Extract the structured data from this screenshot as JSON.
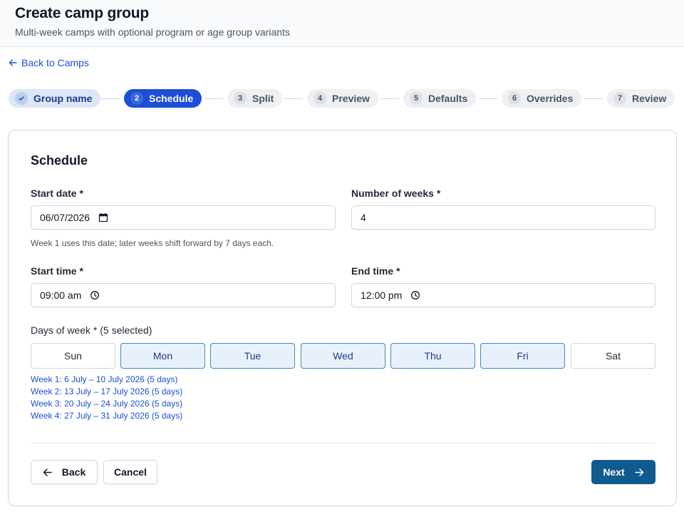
{
  "header": {
    "title": "Create camp group",
    "subtitle": "Multi-week camps with optional program or age group variants"
  },
  "back_link": "Back to Camps",
  "steps": [
    {
      "num": "",
      "label": "Group name",
      "state": "done"
    },
    {
      "num": "2",
      "label": "Schedule",
      "state": "active"
    },
    {
      "num": "3",
      "label": "Split",
      "state": "pending"
    },
    {
      "num": "4",
      "label": "Preview",
      "state": "pending"
    },
    {
      "num": "5",
      "label": "Defaults",
      "state": "pending"
    },
    {
      "num": "6",
      "label": "Overrides",
      "state": "pending"
    },
    {
      "num": "7",
      "label": "Review",
      "state": "pending"
    }
  ],
  "schedule": {
    "heading": "Schedule",
    "start_date_label": "Start date *",
    "start_date_value": "06/07/2026",
    "start_date_hint": "Week 1 uses this date; later weeks shift forward by 7 days each.",
    "weeks_label": "Number of weeks *",
    "weeks_value": "4",
    "start_time_label": "Start time *",
    "start_time_value": "09:00 am",
    "end_time_label": "End time *",
    "end_time_value": "12:00 pm",
    "days_label": "Days of week * (5 selected)",
    "days": [
      {
        "label": "Sun",
        "selected": false
      },
      {
        "label": "Mon",
        "selected": true
      },
      {
        "label": "Tue",
        "selected": true
      },
      {
        "label": "Wed",
        "selected": true
      },
      {
        "label": "Thu",
        "selected": true
      },
      {
        "label": "Fri",
        "selected": true
      },
      {
        "label": "Sat",
        "selected": false
      }
    ],
    "week_summaries": [
      "Week 1: 6 July – 10 July 2026 (5 days)",
      "Week 2: 13 July – 17 July 2026 (5 days)",
      "Week 3: 20 July – 24 July 2026 (5 days)",
      "Week 4: 27 July – 31 July 2026 (5 days)"
    ]
  },
  "footer": {
    "back_label": "Back",
    "cancel_label": "Cancel",
    "next_label": "Next"
  },
  "colors": {
    "accent": "#1d4ed8",
    "primary_button": "#0f5b8e",
    "selected_day_bg": "#e8f1fb"
  },
  "icons": {
    "back_link": "arrow-left-icon",
    "done_step": "check-icon",
    "date_field": "calendar-icon",
    "time_field": "clock-icon",
    "back_button": "arrow-left-icon",
    "next_button": "arrow-right-icon"
  }
}
